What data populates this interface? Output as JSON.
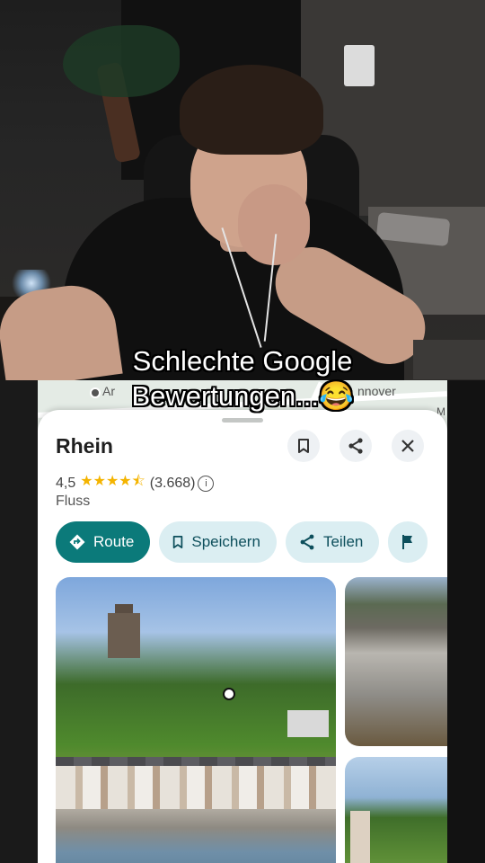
{
  "caption": {
    "line1": "Schlechte Google",
    "line2": "Bewertungen...😂"
  },
  "map": {
    "label_left": "Ar",
    "label_right": "nnover",
    "label_corner": "M"
  },
  "place": {
    "title": "Rhein",
    "rating": "4,5",
    "stars": "★★★★⯪",
    "review_count": "(3.668)",
    "category": "Fluss"
  },
  "actions": {
    "route": "Route",
    "save": "Speichern",
    "share": "Teilen"
  },
  "icons": {
    "bookmark": "bookmark-icon",
    "share": "share-icon",
    "close": "close-icon",
    "directions": "directions-icon",
    "flag": "flag-icon",
    "info": "info-icon"
  },
  "colors": {
    "accent": "#0b7a7a",
    "chip_tonal": "#dbeef2",
    "star": "#f4b400"
  }
}
